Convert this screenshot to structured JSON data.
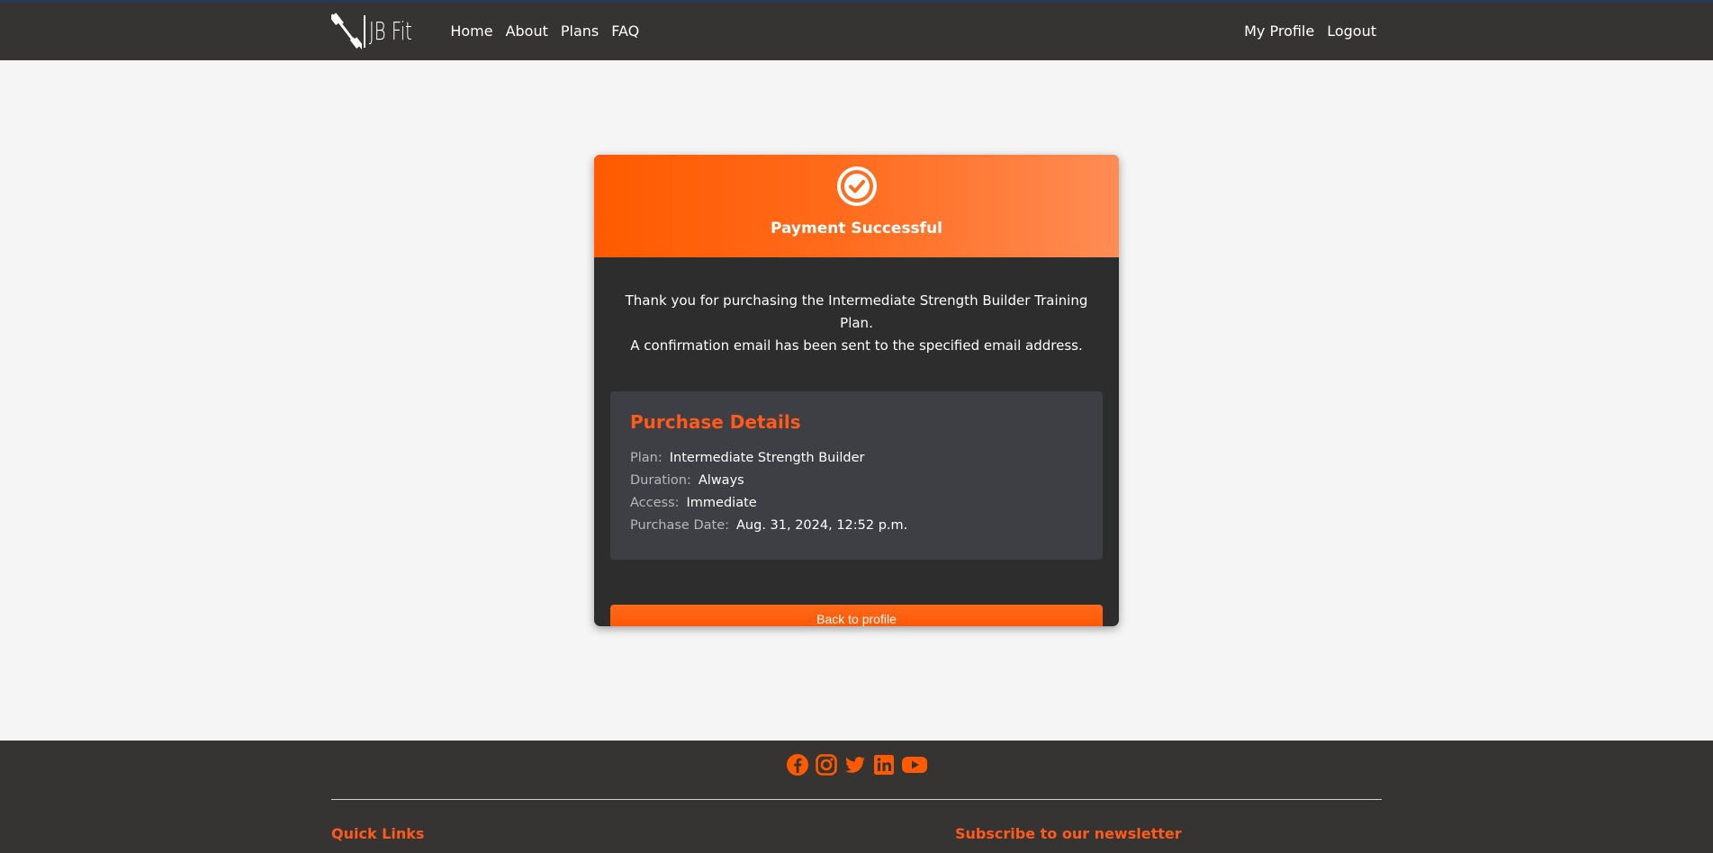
{
  "nav": {
    "logo_text": "JB Fit",
    "links": [
      "Home",
      "About",
      "Plans",
      "FAQ"
    ],
    "right_links": [
      "My Profile",
      "Logout"
    ]
  },
  "card": {
    "title": "Payment Successful",
    "message_line1": "Thank you for purchasing the Intermediate Strength Builder Training Plan.",
    "message_line2": "A confirmation email has been sent to the specified email address.",
    "details_title": "Purchase Details",
    "details": [
      {
        "label": "Plan:",
        "value": "Intermediate Strength Builder"
      },
      {
        "label": "Duration:",
        "value": "Always"
      },
      {
        "label": "Access:",
        "value": "Immediate"
      },
      {
        "label": "Purchase Date:",
        "value": "Aug. 31, 2024, 12:52 p.m."
      }
    ],
    "button_label": "Back to profile"
  },
  "footer": {
    "socials": [
      "facebook-icon",
      "instagram-icon",
      "twitter-icon",
      "linkedin-icon",
      "youtube-icon"
    ],
    "quick_links_title": "Quick Links",
    "newsletter_title": "Subscribe to our newsletter"
  },
  "colors": {
    "accent": "#ff5a00",
    "nav_bg": "#353432",
    "card_bg": "#2d2d2d",
    "details_bg": "#3d3f44",
    "page_bg": "#f5f5f5"
  }
}
